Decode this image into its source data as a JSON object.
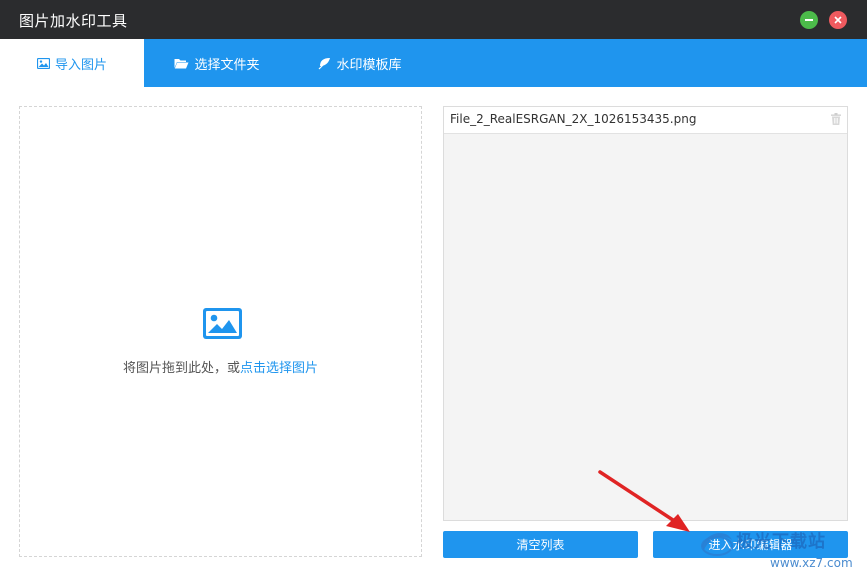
{
  "app": {
    "title": "图片加水印工具"
  },
  "window_controls": {
    "minimize_icon": "minus-icon",
    "close_icon": "x-icon"
  },
  "tabs": [
    {
      "label": "导入图片",
      "icon": "image-icon",
      "active": true
    },
    {
      "label": "选择文件夹",
      "icon": "folder-open-icon",
      "active": false
    },
    {
      "label": "水印模板库",
      "icon": "leaf-icon",
      "active": false
    }
  ],
  "dropzone": {
    "prompt": "将图片拖到此处，或",
    "link": "点击选择图片"
  },
  "file_list": {
    "items": [
      {
        "name": "File_2_RealESRGAN_2X_1026153435.png"
      }
    ]
  },
  "buttons": {
    "clear": "清空列表",
    "editor": "进入水印编辑器"
  },
  "watermark": {
    "text": "极光下载站",
    "url": "www.xz7.com"
  },
  "colors": {
    "accent": "#1f95ee",
    "titlebar": "#2b2c2e",
    "minimize": "#4cbb4a",
    "close": "#ef5a5f",
    "annotation_arrow": "#e02424"
  }
}
